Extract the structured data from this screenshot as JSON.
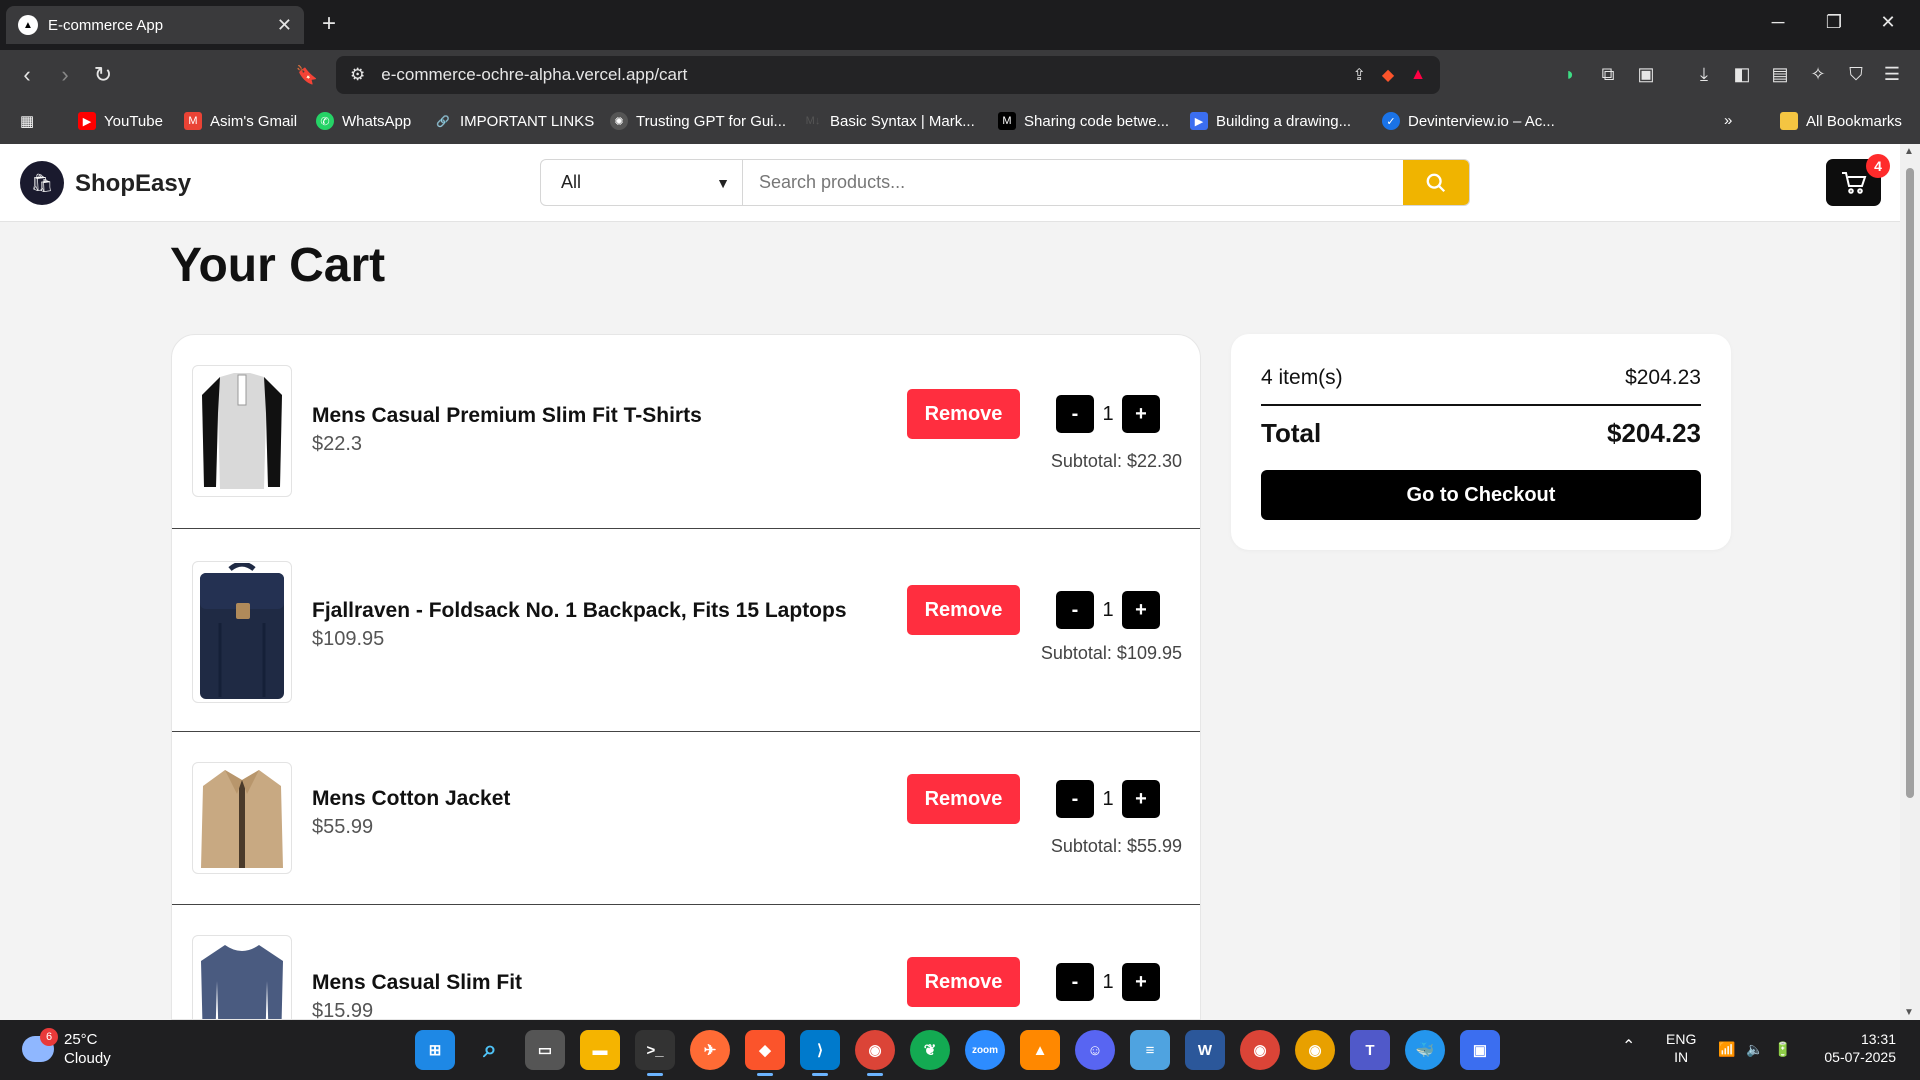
{
  "browser": {
    "tab_title": "E-commerce App",
    "new_tab_icon": "+",
    "url": "e-commerce-ochre-alpha.vercel.app/cart",
    "bookmarks": [
      {
        "label": "YouTube",
        "color": "#ff0000",
        "glyph": "▶"
      },
      {
        "label": "Asim's Gmail",
        "color": "#ea4335",
        "glyph": "M"
      },
      {
        "label": "WhatsApp",
        "color": "#25d366",
        "glyph": "✆"
      },
      {
        "label": "IMPORTANT LINKS",
        "color": "#5f6368",
        "glyph": "🔗"
      },
      {
        "label": "Trusting GPT for Gui...",
        "color": "#555555",
        "glyph": "✺"
      },
      {
        "label": "Basic Syntax | Mark...",
        "color": "#3a3a3c",
        "glyph": "M↓"
      },
      {
        "label": "Sharing code betwe...",
        "color": "#000000",
        "glyph": "M"
      },
      {
        "label": "Building a drawing...",
        "color": "#3b6ef0",
        "glyph": "▶"
      },
      {
        "label": "Devinterview.io – Ac...",
        "color": "#1a73e8",
        "glyph": "✓"
      }
    ],
    "all_bookmarks_label": "All Bookmarks"
  },
  "header": {
    "brand": "ShopEasy",
    "category_selected": "All",
    "search_placeholder": "Search products...",
    "cart_count": "4"
  },
  "page": {
    "title": "Your Cart",
    "remove_label": "Remove",
    "minus_label": "-",
    "plus_label": "+",
    "items": [
      {
        "name": "Mens Casual Premium Slim Fit T-Shirts",
        "price": "$22.3",
        "qty": "1",
        "subtotal": "Subtotal: $22.30",
        "icon": "tshirt-icon"
      },
      {
        "name": "Fjallraven - Foldsack No. 1 Backpack, Fits 15 Laptops",
        "price": "$109.95",
        "qty": "1",
        "subtotal": "Subtotal: $109.95",
        "icon": "backpack-icon"
      },
      {
        "name": "Mens Cotton Jacket",
        "price": "$55.99",
        "qty": "1",
        "subtotal": "Subtotal: $55.99",
        "icon": "jacket-icon"
      },
      {
        "name": "Mens Casual Slim Fit",
        "price": "$15.99",
        "qty": "1",
        "subtotal": "",
        "icon": "longsleeve-icon"
      }
    ]
  },
  "summary": {
    "items_label": "4 item(s)",
    "items_total": "$204.23",
    "total_label": "Total",
    "total_value": "$204.23",
    "checkout_label": "Go to Checkout"
  },
  "taskbar": {
    "weather_temp": "25°C",
    "weather_desc": "Cloudy",
    "weather_badge": "6",
    "lang": "ENG",
    "region": "IN",
    "time": "13:31",
    "date": "05-07-2025"
  },
  "colors": {
    "accent_search": "#f0b400",
    "remove_red": "#ff2e3f",
    "badge_red": "#ff2b2b"
  }
}
